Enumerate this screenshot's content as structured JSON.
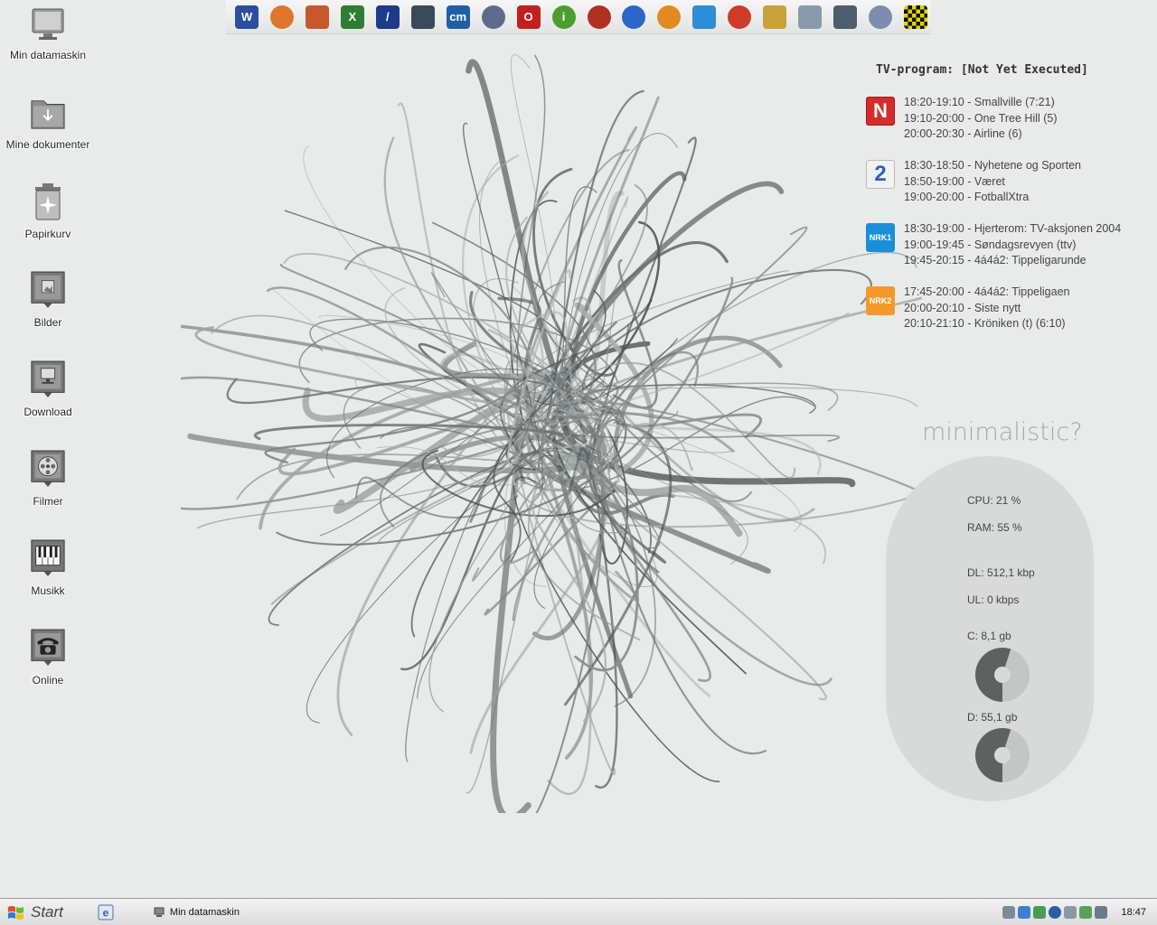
{
  "desktop": {
    "icons": [
      {
        "label": "Min datamaskin",
        "icon": "monitor-icon"
      },
      {
        "label": "Mine dokumenter",
        "icon": "folder-icon"
      },
      {
        "label": "Papirkurv",
        "icon": "recycle-bin-icon"
      },
      {
        "label": "Bilder",
        "icon": "pictures-icon"
      },
      {
        "label": "Download",
        "icon": "download-icon"
      },
      {
        "label": "Filmer",
        "icon": "film-reel-icon"
      },
      {
        "label": "Musikk",
        "icon": "piano-icon"
      },
      {
        "label": "Online",
        "icon": "telephone-icon"
      }
    ]
  },
  "dock": {
    "items": [
      {
        "icon": "word-icon",
        "glyph": "W",
        "color": "#2b4f9e"
      },
      {
        "icon": "firefox-icon",
        "glyph": "",
        "color": "#e0762b"
      },
      {
        "icon": "powerpoint-icon",
        "glyph": "",
        "color": "#c8572b"
      },
      {
        "icon": "excel-icon",
        "glyph": "X",
        "color": "#2f7d32"
      },
      {
        "icon": "slash-app-icon",
        "glyph": "/",
        "color": "#1e3a8a"
      },
      {
        "icon": "terminal-icon",
        "glyph": "",
        "color": "#3a4a5a"
      },
      {
        "icon": "cm-icon",
        "glyph": "cm",
        "color": "#1f5fa8"
      },
      {
        "icon": "globe-icon",
        "glyph": "",
        "color": "#5a6d8f"
      },
      {
        "icon": "opera-icon",
        "glyph": "O",
        "color": "#c21f1f"
      },
      {
        "icon": "info-icon",
        "glyph": "i",
        "color": "#4b9e2e"
      },
      {
        "icon": "media-icon",
        "glyph": "",
        "color": "#b03020"
      },
      {
        "icon": "play-icon",
        "glyph": "",
        "color": "#2b66c8"
      },
      {
        "icon": "shell-icon",
        "glyph": "",
        "color": "#e28a1f"
      },
      {
        "icon": "sync-icon",
        "glyph": "",
        "color": "#2a8fd6"
      },
      {
        "icon": "messenger-icon",
        "glyph": "",
        "color": "#cf3b2b"
      },
      {
        "icon": "pencils-icon",
        "glyph": "",
        "color": "#c9a13a"
      },
      {
        "icon": "paper-icon",
        "glyph": "",
        "color": "#8a9aaa"
      },
      {
        "icon": "drive-icon",
        "glyph": "",
        "color": "#4c5d6e"
      },
      {
        "icon": "disc-icon",
        "glyph": "",
        "color": "#7b8db0"
      },
      {
        "icon": "checker-icon",
        "glyph": "",
        "color": "#e4d300"
      }
    ]
  },
  "tv": {
    "title": "TV-program: [Not Yet Executed]",
    "channels": [
      {
        "logo_text": "N",
        "logo_color": "#d62b2b",
        "logo_icon": "tvnorge-logo-icon",
        "lines": [
          "18:20-19:10 - Smallville (7:21)",
          "19:10-20:00 - One Tree Hill (5)",
          "20:00-20:30 - Airline (6)"
        ]
      },
      {
        "logo_text": "2",
        "logo_color": "#f2f2f2",
        "logo_icon": "tv2-logo-icon",
        "lines": [
          "18:30-18:50 - Nyhetene og Sporten",
          "18:50-19:00 - Været",
          "19:00-20:00 - FotballXtra"
        ]
      },
      {
        "logo_text": "NRK1",
        "logo_color": "#1a8fd8",
        "logo_icon": "nrk1-logo-icon",
        "lines": [
          "18:30-19:00 - Hjerterom: TV-aksjonen 2004",
          "19:00-19:45 - Søndagsrevyen (ttv)",
          "19:45-20:15 - 4á4á2: Tippeligarunde"
        ]
      },
      {
        "logo_text": "NRK2",
        "logo_color": "#f39a2b",
        "logo_icon": "nrk2-logo-icon",
        "lines": [
          "17:45-20:00 - 4á4á2: Tippeligaen",
          "20:00-20:10 - Siste nytt",
          "20:10-21:10 - Kröniken (t)  (6:10)"
        ]
      }
    ]
  },
  "monitor": {
    "title": "minimalistic?",
    "cpu": "CPU: 21 %",
    "ram": "RAM: 55 %",
    "dl": "DL: 512,1 kbp",
    "ul": "UL: 0 kbps",
    "c_drive": "C: 8,1 gb",
    "d_drive": "D: 55,1 gb",
    "c_used_fraction": 0.55,
    "d_used_fraction": 0.55
  },
  "taskbar": {
    "start_label": "Start",
    "window_label": "Min datamaskin",
    "clock": "18:47"
  }
}
